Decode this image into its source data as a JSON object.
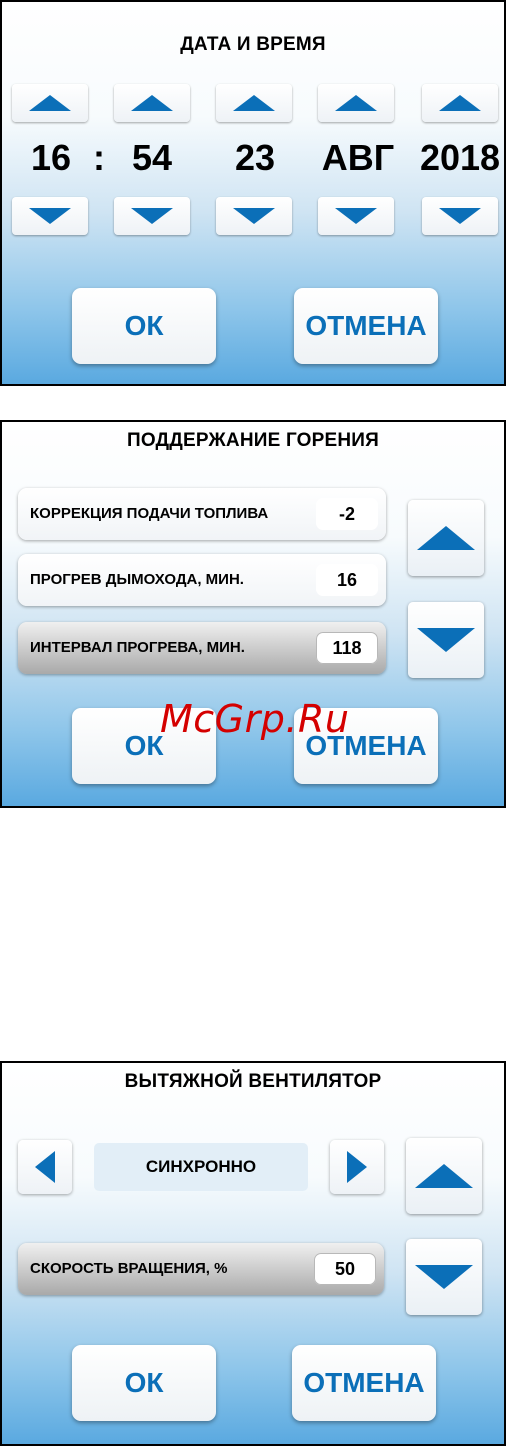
{
  "screen_datetime": {
    "title": "ДАТА И ВРЕМЯ",
    "hour": "16",
    "separator": ":",
    "minute": "54",
    "day": "23",
    "month": "АВГ",
    "year": "2018",
    "ok_label": "ОК",
    "cancel_label": "ОТМЕНА"
  },
  "screen_combustion": {
    "title": "ПОДДЕРЖАНИЕ ГОРЕНИЯ",
    "params": [
      {
        "label": "КОРРЕКЦИЯ ПОДАЧИ ТОПЛИВА",
        "value": "-2",
        "selected": false
      },
      {
        "label": "ПРОГРЕВ ДЫМОХОДА, МИН.",
        "value": "16",
        "selected": false
      },
      {
        "label": "ИНТЕРВАЛ ПРОГРЕВА, МИН.",
        "value": "118",
        "selected": true
      }
    ],
    "ok_label": "ОК",
    "cancel_label": "ОТМЕНА"
  },
  "screen_fan": {
    "title": "ВЫТЯЖНОЙ ВЕНТИЛЯТОР",
    "mode": "СИНХРОННО",
    "speed_label": "СКОРОСТЬ ВРАЩЕНИЯ, %",
    "speed_value": "50",
    "ok_label": "ОК",
    "cancel_label": "ОТМЕНА"
  },
  "watermark": "McGrp.Ru",
  "colors": {
    "accent": "#0b6fb8",
    "watermark": "#d40000"
  }
}
